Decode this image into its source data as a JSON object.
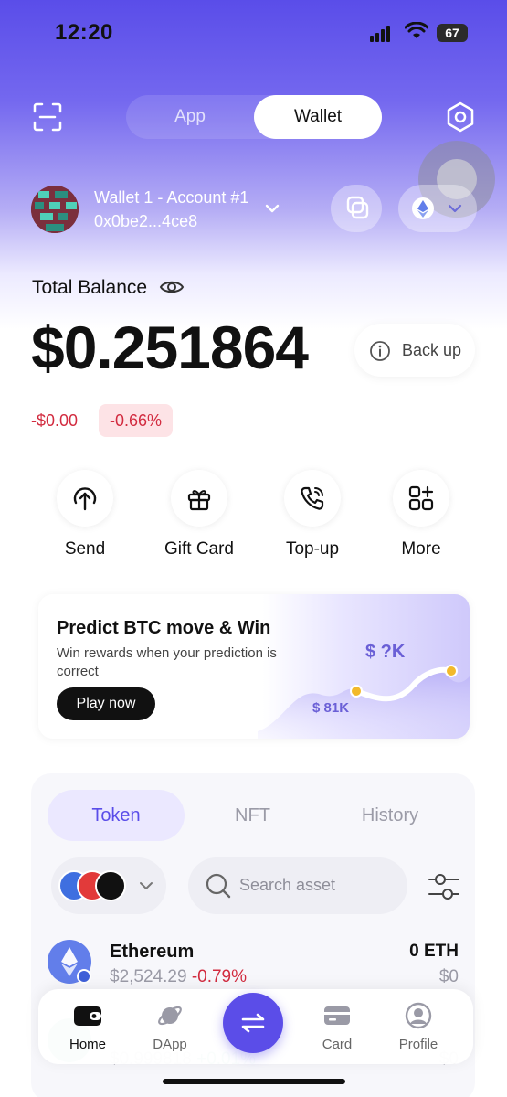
{
  "status_bar": {
    "time": "12:20",
    "battery": "67"
  },
  "top_nav": {
    "mode_app": "App",
    "mode_wallet": "Wallet",
    "active_mode": "Wallet"
  },
  "account": {
    "name": "Wallet 1 - Account #1",
    "address": "0x0be2...4ce8",
    "network_icon": "ethereum-icon"
  },
  "balance": {
    "label": "Total Balance",
    "amount": "$0.251864",
    "change_abs": "-$0.00",
    "change_pct": "-0.66%",
    "backup_label": "Back up"
  },
  "actions": [
    {
      "label": "Send",
      "icon": "send-icon"
    },
    {
      "label": "Gift Card",
      "icon": "gift-icon"
    },
    {
      "label": "Top-up",
      "icon": "phone-icon"
    },
    {
      "label": "More",
      "icon": "grid-plus-icon"
    }
  ],
  "promo": {
    "title": "Predict BTC move & Win",
    "subtitle": "Win rewards when your prediction is correct",
    "button": "Play now",
    "target": "$ ?K",
    "current": "$ 81K"
  },
  "assets": {
    "tabs": [
      "Token",
      "NFT",
      "History"
    ],
    "active_tab": "Token",
    "search_placeholder": "Search asset",
    "tokens": [
      {
        "name": "Ethereum",
        "price": "$2,524.29",
        "change": "-0.79%",
        "balance": "0 ETH",
        "value": "$0"
      },
      {
        "name": "",
        "price": "$0.999818",
        "change": "+0.01%",
        "balance": "",
        "value": "$0"
      }
    ]
  },
  "bottom_nav": {
    "items": [
      {
        "label": "Home",
        "icon": "wallet-icon",
        "active": true
      },
      {
        "label": "DApp",
        "icon": "planet-icon",
        "active": false
      },
      {
        "label": "Card",
        "icon": "card-icon",
        "active": false
      },
      {
        "label": "Profile",
        "icon": "profile-icon",
        "active": false
      }
    ],
    "swap_icon": "swap-icon"
  },
  "colors": {
    "accent": "#5b4de8",
    "negative": "#d22b3f",
    "positive": "#18a964"
  }
}
